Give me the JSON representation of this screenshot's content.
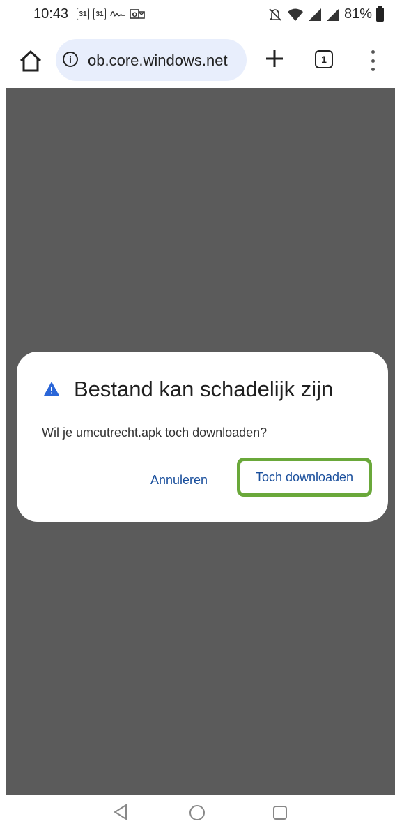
{
  "status_bar": {
    "time": "10:43",
    "calendar_icons": [
      "31",
      "31"
    ],
    "battery": "81%"
  },
  "toolbar": {
    "url": "ob.core.windows.net",
    "tab_count": "1"
  },
  "dialog": {
    "title": "Bestand kan schadelijk zijn",
    "message": "Wil je umcutrecht.apk toch downloaden?",
    "cancel_label": "Annuleren",
    "download_label": "Toch downloaden"
  },
  "colors": {
    "accent_text": "#1a4f9c",
    "highlight_border": "#6aa83a",
    "warning_icon": "#2a66d8",
    "page_overlay": "#5b5b5b"
  }
}
